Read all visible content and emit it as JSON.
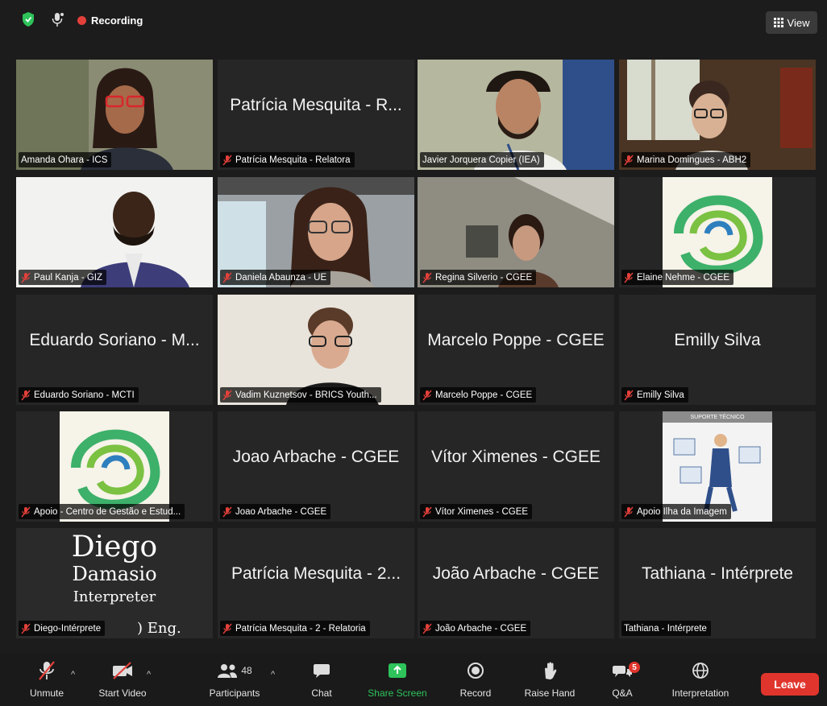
{
  "header": {
    "recording_label": "Recording",
    "view_label": "View",
    "colors": {
      "shield": "#2ec35b",
      "recording": "#e3403a"
    }
  },
  "tiles": [
    {
      "label": "Amanda Ohara - ICS",
      "big": "",
      "muted": false,
      "active": false
    },
    {
      "label": "Patrícia Mesquita - Relatora",
      "big": "Patrícia Mesquita - R...",
      "muted": true,
      "active": false
    },
    {
      "label": "Javier Jorquera Copier (IEA)",
      "big": "",
      "muted": false,
      "active": true
    },
    {
      "label": "Marina Domingues - ABH2",
      "big": "",
      "muted": true,
      "active": false
    },
    {
      "label": "Paul Kanja - GIZ",
      "big": "",
      "muted": true,
      "active": false
    },
    {
      "label": "Daniela Abaunza - UE",
      "big": "",
      "muted": true,
      "active": false
    },
    {
      "label": "Regina Silverio - CGEE",
      "big": "",
      "muted": true,
      "active": false
    },
    {
      "label": "Elaine Nehme - CGEE",
      "big": "",
      "muted": true,
      "active": false
    },
    {
      "label": "Eduardo Soriano - MCTI",
      "big": "Eduardo Soriano - M...",
      "muted": true,
      "active": false
    },
    {
      "label": "Vadim Kuznetsov - BRICS Youth...",
      "big": "",
      "muted": true,
      "active": false
    },
    {
      "label": "Marcelo Poppe - CGEE",
      "big": "Marcelo Poppe - CGEE",
      "muted": true,
      "active": false
    },
    {
      "label": "Emilly Silva",
      "big": "Emilly Silva",
      "muted": true,
      "active": false
    },
    {
      "label": "Apoio - Centro de Gestão e Estud...",
      "big": "",
      "muted": true,
      "active": false
    },
    {
      "label": "Joao Arbache - CGEE",
      "big": "Joao Arbache - CGEE",
      "muted": true,
      "active": false
    },
    {
      "label": "Vítor Ximenes - CGEE",
      "big": "Vítor Ximenes - CGEE",
      "muted": true,
      "active": false
    },
    {
      "label": "Apoio Ilha da Imagem",
      "big": "",
      "muted": true,
      "active": false
    },
    {
      "label": "Diego-Intérprete",
      "big": "",
      "muted": true,
      "active": false
    },
    {
      "label": "Patrícia Mesquita - 2 - Relatoria",
      "big": "Patrícia Mesquita - 2...",
      "muted": true,
      "active": false
    },
    {
      "label": "João Arbache - CGEE",
      "big": "João Arbache - CGEE",
      "muted": true,
      "active": false
    },
    {
      "label": "Tathiana - Intérprete",
      "big": "Tathiana - Intérprete",
      "muted": false,
      "active": false
    }
  ],
  "diego_card": {
    "line1": "Diego",
    "line2": "Damasio",
    "line3": "Interpreter",
    "line4": ") Eng."
  },
  "support_card": {
    "title": "SUPORTE TÉCNICO"
  },
  "toolbar": {
    "unmute": "Unmute",
    "start_video": "Start Video",
    "participants": "Participants",
    "participants_count": "48",
    "chat": "Chat",
    "share_screen": "Share Screen",
    "record": "Record",
    "raise_hand": "Raise Hand",
    "qa": "Q&A",
    "qa_badge": "5",
    "interpretation": "Interpretation",
    "leave": "Leave",
    "share_color": "#2ec35b",
    "leave_color": "#e0352d"
  }
}
